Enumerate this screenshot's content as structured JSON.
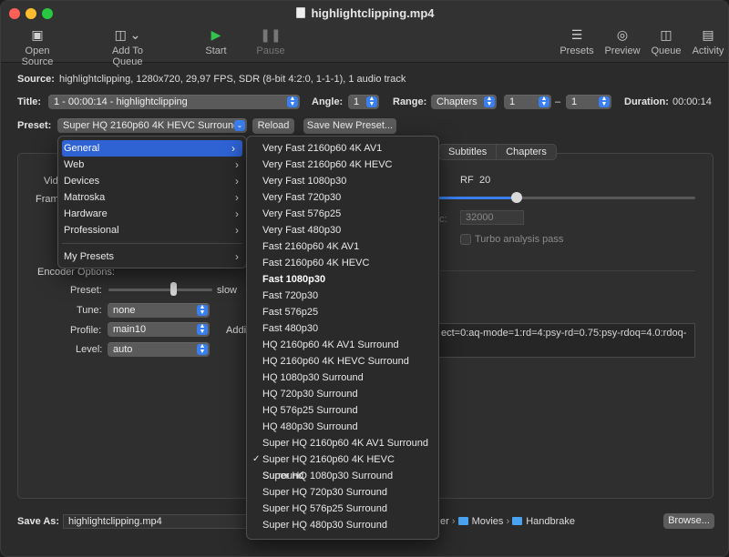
{
  "window": {
    "title": "highlightclipping.mp4"
  },
  "toolbar": {
    "open_source": "Open Source",
    "add_to_queue": "Add To Queue",
    "start": "Start",
    "pause": "Pause",
    "presets": "Presets",
    "preview": "Preview",
    "queue": "Queue",
    "activity": "Activity"
  },
  "source": {
    "label": "Source:",
    "value": "highlightclipping, 1280x720, 29,97 FPS, SDR (8-bit 4:2:0, 1-1-1), 1 audio track"
  },
  "title_row": {
    "title_label": "Title:",
    "title_value": "1 - 00:00:14 - highlightclipping",
    "angle_label": "Angle:",
    "angle_value": "1",
    "range_label": "Range:",
    "range_type": "Chapters",
    "range_start": "1",
    "range_dash": "–",
    "range_end": "1",
    "duration_label": "Duration:",
    "duration_value": "00:00:14"
  },
  "preset_row": {
    "label": "Preset:",
    "value": "Super HQ 2160p60 4K HEVC Surround",
    "reload": "Reload",
    "save_new": "Save New Preset..."
  },
  "tabs": [
    "Subtitles",
    "Chapters"
  ],
  "video": {
    "video_label_partial": "Vid",
    "frame_label_partial": "Fram",
    "rf_label": "RF",
    "rf_value": "20",
    "bitrate_partial": "c:",
    "bitrate_value": "32000",
    "turbo_label": "Turbo analysis pass",
    "encoder_options_label": "Encoder Options:",
    "preset_label": "Preset:",
    "preset_slow": "slow",
    "tune_label": "Tune:",
    "tune_value": "none",
    "profile_label": "Profile:",
    "profile_value": "main10",
    "level_label": "Level:",
    "level_value": "auto",
    "additional_partial": "Addi",
    "options_text": "ect=0:aq-mode=1:rd=4:psy-rd=0.75:psy-rdoq=4.0:rdoq-"
  },
  "category_menu": {
    "items": [
      {
        "label": "General",
        "selected": true
      },
      {
        "label": "Web"
      },
      {
        "label": "Devices"
      },
      {
        "label": "Matroska"
      },
      {
        "label": "Hardware"
      },
      {
        "label": "Professional"
      }
    ],
    "my_presets": "My Presets"
  },
  "preset_menu": {
    "items": [
      {
        "label": "Very Fast 2160p60 4K AV1"
      },
      {
        "label": "Very Fast 2160p60 4K HEVC"
      },
      {
        "label": "Very Fast 1080p30"
      },
      {
        "label": "Very Fast 720p30"
      },
      {
        "label": "Very Fast 576p25"
      },
      {
        "label": "Very Fast 480p30"
      },
      {
        "label": "Fast 2160p60 4K AV1"
      },
      {
        "label": "Fast 2160p60 4K HEVC"
      },
      {
        "label": "Fast 1080p30",
        "bold": true
      },
      {
        "label": "Fast 720p30"
      },
      {
        "label": "Fast 576p25"
      },
      {
        "label": "Fast 480p30"
      },
      {
        "label": "HQ 2160p60 4K AV1 Surround"
      },
      {
        "label": "HQ 2160p60 4K HEVC Surround"
      },
      {
        "label": "HQ 1080p30 Surround"
      },
      {
        "label": "HQ 720p30 Surround"
      },
      {
        "label": "HQ 576p25 Surround"
      },
      {
        "label": "HQ 480p30 Surround"
      },
      {
        "label": "Super HQ 2160p60 4K AV1 Surround"
      },
      {
        "label": "Super HQ 2160p60 4K HEVC Surround",
        "checked": true
      },
      {
        "label": "Super HQ 1080p30 Surround"
      },
      {
        "label": "Super HQ 720p30 Surround"
      },
      {
        "label": "Super HQ 576p25 Surround"
      },
      {
        "label": "Super HQ 480p30 Surround"
      }
    ]
  },
  "save_row": {
    "label": "Save As:",
    "value": "highlightclipping.mp4",
    "path_partial": "er",
    "folder1": "Movies",
    "folder2": "Handbrake",
    "browse": "Browse..."
  }
}
